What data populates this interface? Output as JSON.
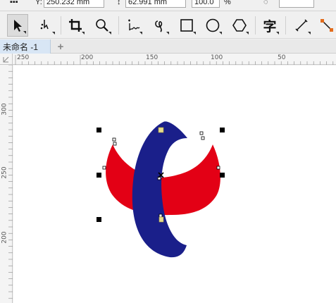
{
  "property_bar": {
    "y_label": "Y:",
    "y_value": "250.232 mm",
    "height_value": "62.991 mm",
    "scale_value": "100.0",
    "percent": "%"
  },
  "toolbox": {
    "tools": [
      {
        "name": "pick-tool",
        "icon": "arrow-icon"
      },
      {
        "name": "shape-tool",
        "icon": "shape-edit-icon"
      },
      {
        "name": "crop-tool",
        "icon": "crop-icon"
      },
      {
        "name": "zoom-tool",
        "icon": "magnifier-icon"
      },
      {
        "name": "freehand-tool",
        "icon": "freehand-icon"
      },
      {
        "name": "artistic-media-tool",
        "icon": "curve-icon"
      },
      {
        "name": "rectangle-tool",
        "icon": "rectangle-icon"
      },
      {
        "name": "ellipse-tool",
        "icon": "ellipse-icon"
      },
      {
        "name": "polygon-tool",
        "icon": "hexagon-icon"
      },
      {
        "name": "text-tool",
        "label": "字"
      },
      {
        "name": "dimension-tool",
        "icon": "line-icon"
      },
      {
        "name": "connector-tool",
        "icon": "connector-icon"
      }
    ]
  },
  "document": {
    "tab_label": "未命名 -1",
    "add_tab": "+"
  },
  "rulers": {
    "horizontal_labels": [
      "250",
      "200",
      "150",
      "100",
      "50"
    ],
    "vertical_labels": [
      "300",
      "250",
      "200"
    ]
  },
  "colors": {
    "logo_blue": "#1a1f8a",
    "logo_red": "#e30015",
    "handle_fill": "#000000",
    "canvas_bg": "#ffffff"
  }
}
